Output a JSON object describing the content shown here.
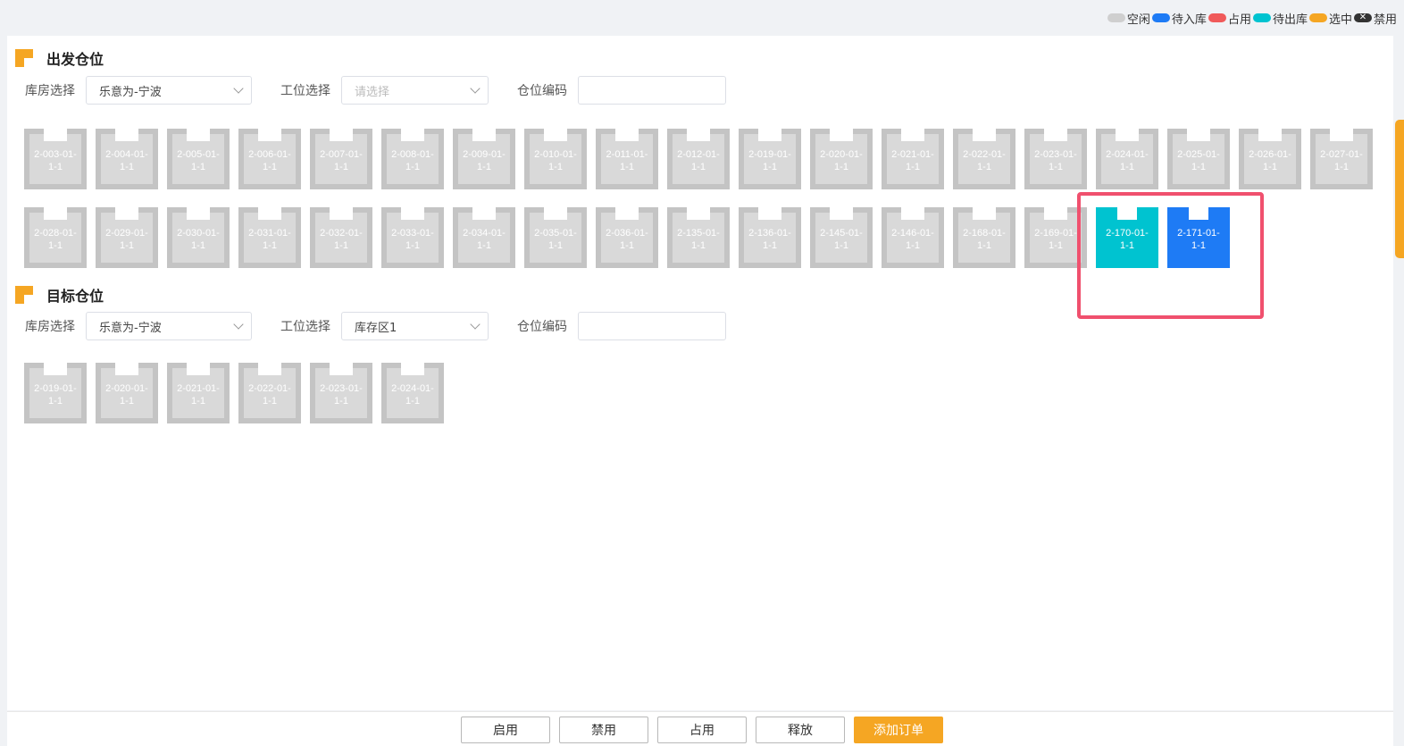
{
  "legend": [
    {
      "label": "空闲",
      "color": "#cfcfcf",
      "x": false
    },
    {
      "label": "待入库",
      "color": "#1e7bf5",
      "x": false
    },
    {
      "label": "占用",
      "color": "#f05a5a",
      "x": false
    },
    {
      "label": "待出库",
      "color": "#00c3d0",
      "x": false
    },
    {
      "label": "选中",
      "color": "#f5a623",
      "x": false
    },
    {
      "label": "禁用",
      "color": "#333333",
      "x": true
    }
  ],
  "source": {
    "title": "出发仓位",
    "warehouse_label": "库房选择",
    "warehouse_value": "乐意为-宁波",
    "station_label": "工位选择",
    "station_placeholder": "请选择",
    "code_label": "仓位编码",
    "code_value": "",
    "slots": [
      {
        "line1": "2-003-01-",
        "line2": "1-1",
        "status": "free"
      },
      {
        "line1": "2-004-01-",
        "line2": "1-1",
        "status": "free"
      },
      {
        "line1": "2-005-01-",
        "line2": "1-1",
        "status": "free"
      },
      {
        "line1": "2-006-01-",
        "line2": "1-1",
        "status": "free"
      },
      {
        "line1": "2-007-01-",
        "line2": "1-1",
        "status": "free"
      },
      {
        "line1": "2-008-01-",
        "line2": "1-1",
        "status": "free"
      },
      {
        "line1": "2-009-01-",
        "line2": "1-1",
        "status": "free"
      },
      {
        "line1": "2-010-01-",
        "line2": "1-1",
        "status": "free"
      },
      {
        "line1": "2-011-01-",
        "line2": "1-1",
        "status": "free"
      },
      {
        "line1": "2-012-01-",
        "line2": "1-1",
        "status": "free"
      },
      {
        "line1": "2-019-01-",
        "line2": "1-1",
        "status": "free"
      },
      {
        "line1": "2-020-01-",
        "line2": "1-1",
        "status": "free"
      },
      {
        "line1": "2-021-01-",
        "line2": "1-1",
        "status": "free"
      },
      {
        "line1": "2-022-01-",
        "line2": "1-1",
        "status": "free"
      },
      {
        "line1": "2-023-01-",
        "line2": "1-1",
        "status": "free"
      },
      {
        "line1": "2-024-01-",
        "line2": "1-1",
        "status": "free"
      },
      {
        "line1": "2-025-01-",
        "line2": "1-1",
        "status": "free"
      },
      {
        "line1": "2-026-01-",
        "line2": "1-1",
        "status": "free"
      },
      {
        "line1": "2-027-01-",
        "line2": "1-1",
        "status": "free"
      },
      {
        "line1": "2-028-01-",
        "line2": "1-1",
        "status": "free"
      },
      {
        "line1": "2-029-01-",
        "line2": "1-1",
        "status": "free"
      },
      {
        "line1": "2-030-01-",
        "line2": "1-1",
        "status": "free"
      },
      {
        "line1": "2-031-01-",
        "line2": "1-1",
        "status": "free"
      },
      {
        "line1": "2-032-01-",
        "line2": "1-1",
        "status": "free"
      },
      {
        "line1": "2-033-01-",
        "line2": "1-1",
        "status": "free"
      },
      {
        "line1": "2-034-01-",
        "line2": "1-1",
        "status": "free"
      },
      {
        "line1": "2-035-01-",
        "line2": "1-1",
        "status": "free"
      },
      {
        "line1": "2-036-01-",
        "line2": "1-1",
        "status": "free"
      },
      {
        "line1": "2-135-01-",
        "line2": "1-1",
        "status": "free"
      },
      {
        "line1": "2-136-01-",
        "line2": "1-1",
        "status": "free"
      },
      {
        "line1": "2-145-01-",
        "line2": "1-1",
        "status": "free"
      },
      {
        "line1": "2-146-01-",
        "line2": "1-1",
        "status": "free"
      },
      {
        "line1": "2-168-01-",
        "line2": "1-1",
        "status": "free"
      },
      {
        "line1": "2-169-01-",
        "line2": "1-1",
        "status": "free"
      },
      {
        "line1": "2-170-01-",
        "line2": "1-1",
        "status": "outbound"
      },
      {
        "line1": "2-171-01-",
        "line2": "1-1",
        "status": "inbound"
      }
    ]
  },
  "target": {
    "title": "目标仓位",
    "warehouse_label": "库房选择",
    "warehouse_value": "乐意为-宁波",
    "station_label": "工位选择",
    "station_value": "库存区1",
    "code_label": "仓位编码",
    "code_value": "",
    "slots": [
      {
        "line1": "2-019-01-",
        "line2": "1-1",
        "status": "free"
      },
      {
        "line1": "2-020-01-",
        "line2": "1-1",
        "status": "free"
      },
      {
        "line1": "2-021-01-",
        "line2": "1-1",
        "status": "free"
      },
      {
        "line1": "2-022-01-",
        "line2": "1-1",
        "status": "free"
      },
      {
        "line1": "2-023-01-",
        "line2": "1-1",
        "status": "free"
      },
      {
        "line1": "2-024-01-",
        "line2": "1-1",
        "status": "free"
      }
    ]
  },
  "status_colors": {
    "outbound": "#00c3d0",
    "inbound": "#1e7bf5"
  },
  "buttons": {
    "enable": "启用",
    "disable": "禁用",
    "occupy": "占用",
    "release": "释放",
    "add_order": "添加订单"
  }
}
